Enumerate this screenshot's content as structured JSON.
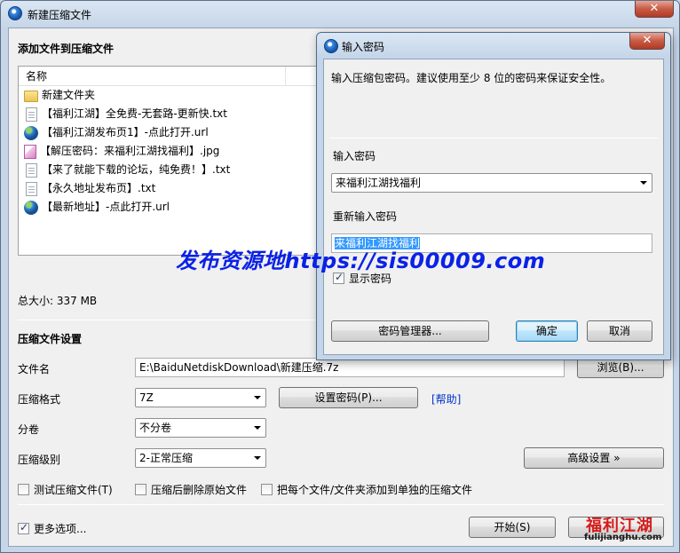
{
  "main": {
    "title": "新建压缩文件",
    "close_glyph": "✕",
    "add_files_title": "添加文件到压缩文件",
    "list_header": "名称",
    "files": [
      {
        "name": "新建文件夹",
        "icon": "folder-icon"
      },
      {
        "name": "【福利江湖】全免费-无套路-更新快.txt",
        "icon": "text-file-icon"
      },
      {
        "name": "【福利江湖发布页1】-点此打开.url",
        "icon": "globe-icon"
      },
      {
        "name": "【解压密码：来福利江湖找福利】.jpg",
        "icon": "image-file-icon"
      },
      {
        "name": "【来了就能下载的论坛，纯免费！】.txt",
        "icon": "text-file-icon"
      },
      {
        "name": "【永久地址发布页】.txt",
        "icon": "text-file-icon"
      },
      {
        "name": "【最新地址】-点此打开.url",
        "icon": "globe-icon"
      }
    ],
    "total_size": "总大小: 337 MB",
    "settings_title": "压缩文件设置",
    "filename_label": "文件名",
    "filename_value": "E:\\BaiduNetdiskDownload\\新建压缩.7z",
    "browse_button": "浏览(B)...",
    "format_label": "压缩格式",
    "format_value": "7Z",
    "set_password_button": "设置密码(P)...",
    "help_link": "[帮助]",
    "split_label": "分卷",
    "split_value": "不分卷",
    "level_label": "压缩级别",
    "level_value": "2-正常压缩",
    "advanced_button": "高级设置 »",
    "opt_test": "测试压缩文件(T)",
    "opt_delete": "压缩后删除原始文件",
    "opt_separate": "把每个文件/文件夹添加到单独的压缩文件",
    "opt_more": "更多选项...",
    "start_button": "开始(S)"
  },
  "dialog": {
    "title": "输入密码",
    "close_glyph": "✕",
    "hint": "输入压缩包密码。建议使用至少 8 位的密码来保证安全性。",
    "password_label": "输入密码",
    "password_value": "来福利江湖找福利",
    "repeat_label": "重新输入密码",
    "repeat_value": "来福利江湖找福利",
    "show_password": "显示密码",
    "manager_button": "密码管理器...",
    "ok_button": "确定",
    "cancel_button": "取消"
  },
  "overlay": {
    "watermark": "发布资源地https://sis00009.com",
    "logo_main": "福利江湖",
    "logo_sub": "fulijianghu.com"
  }
}
